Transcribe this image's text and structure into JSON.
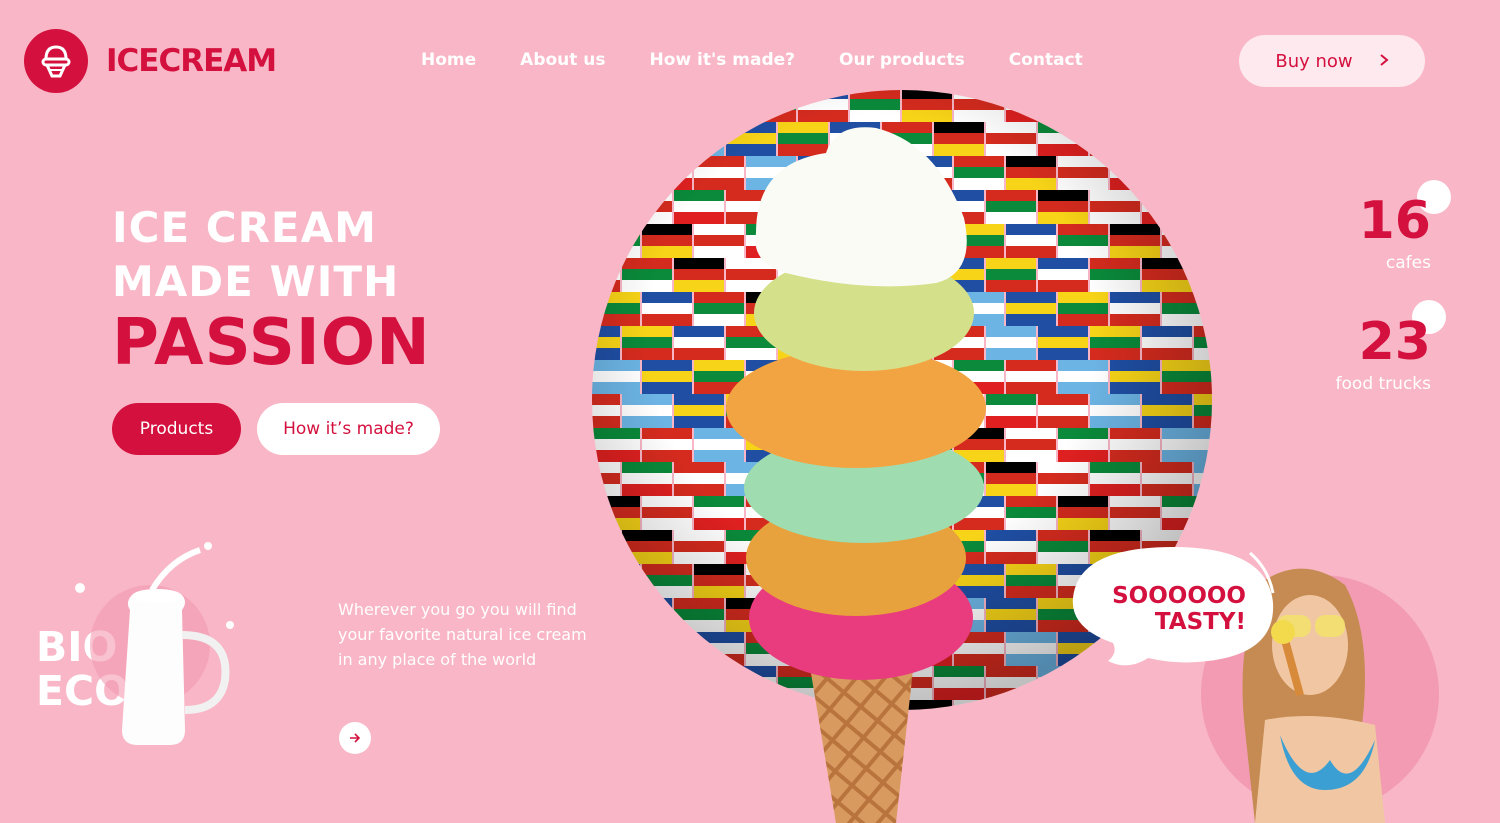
{
  "brand": {
    "name": "ICECREAM"
  },
  "nav": {
    "items": [
      "Home",
      "About us",
      "How it's made?",
      "Our products",
      "Contact"
    ]
  },
  "header": {
    "buy_label": "Buy now",
    "buy_icon": "chevron-right-icon"
  },
  "hero": {
    "line1": "ICE CREAM",
    "line2": "MADE WITH",
    "line3": "PASSION",
    "primary_button": "Products",
    "secondary_button": "How it’s made?"
  },
  "promo": {
    "badge": "BIO\nECO",
    "description": "Wherever you go you will find your favorite natural ice cream in any place of the world",
    "arrow_icon": "arrow-right-icon"
  },
  "stats": [
    {
      "value": "16",
      "label": "cafes"
    },
    {
      "value": "23",
      "label": "food trucks"
    }
  ],
  "speech": {
    "line1": "SOOOOOO",
    "line2": "TASTY!"
  },
  "colors": {
    "background": "#f8b6c6",
    "accent": "#d4113e",
    "button_light": "#fde9ee"
  }
}
